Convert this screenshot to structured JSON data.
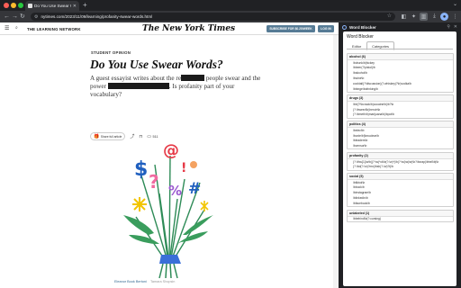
{
  "browser": {
    "tab_title": "Do You Use Swear Words?",
    "url": "nytimes.com/2023/11/09/learning/profanity-swear-words.html"
  },
  "nyt": {
    "section_name": "THE LEARNING NETWORK",
    "logo": "The New York Times",
    "subscribe_label": "SUBSCRIBE FOR $0.25/WEEK",
    "login_label": "LOG IN",
    "kicker": "STUDENT OPINION",
    "headline": "Do You Use Swear Words?",
    "summary_part1": "A guest essayist writes about the re",
    "summary_part2": " people swear and the power",
    "summary_part3": ". Is profanity part of your vocabulary?",
    "share_label": "Share full article",
    "comment_count": "511",
    "credit_name": "Eleanor Book Bertoni",
    "credit_source": "Tamara Shopsin"
  },
  "panel": {
    "header_title": "Word Blocker",
    "body_title": "Word Blocker",
    "tabs": [
      {
        "label": "Editor",
        "active": false
      },
      {
        "label": "Categories",
        "active": true
      }
    ],
    "categories": [
      {
        "title": "alcohol (6)",
        "items": [
          "\\bdrunk\\b|hickey",
          "\\bbeer(?!pistol)\\b",
          "\\balcohol\\b",
          "\\bwine\\b",
          "cocktail(?!discussion)(?:whiskey|?\\b)vodka\\b",
          "\\bbinge\\bdrinking\\b"
        ]
      },
      {
        "title": "drugs (3)",
        "items": [
          "\\bb(?!\\bcrack\\b)cocaine\\b|\\b?\\b",
          "(?:\\bweed\\b)heroin\\b",
          "(?:\\bmeth\\b)marijuana\\b|\\bpot\\b"
        ]
      },
      {
        "title": "politics (4)",
        "items": [
          "\\belect\\b",
          "\\bvote\\b|\\bnuclear\\b",
          "\\bleaders\\b",
          "\\bcensor\\b"
        ]
      },
      {
        "title": "profanity (2)",
        "items": [
          "(?:\\b\\w{1}\\w\\b|(?:\\w)*ck\\b(?:\\w)*)\\b(?:\\w|\\w|\\w)\\b?\\bcrap|\\bhell\\b|\\b",
          "(?:\\bd(?:\\w)?mn|\\bsh(?:\\w)?t)\\b"
        ]
      },
      {
        "title": "social (5)",
        "items": [
          "\\btiktok\\b",
          "\\bbook\\b",
          "\\binstagram\\b",
          "\\blinkedin\\b",
          "\\bfacebook\\b"
        ]
      },
      {
        "title": "unlabeled (1)",
        "items": [
          "\\bbehind\\b(?:cursing)"
        ]
      }
    ]
  },
  "colors": {
    "chrome_dark": "#202124",
    "chrome_toolbar": "#35363a",
    "nyt_button": "#567b95",
    "credit_link": "#326891"
  }
}
